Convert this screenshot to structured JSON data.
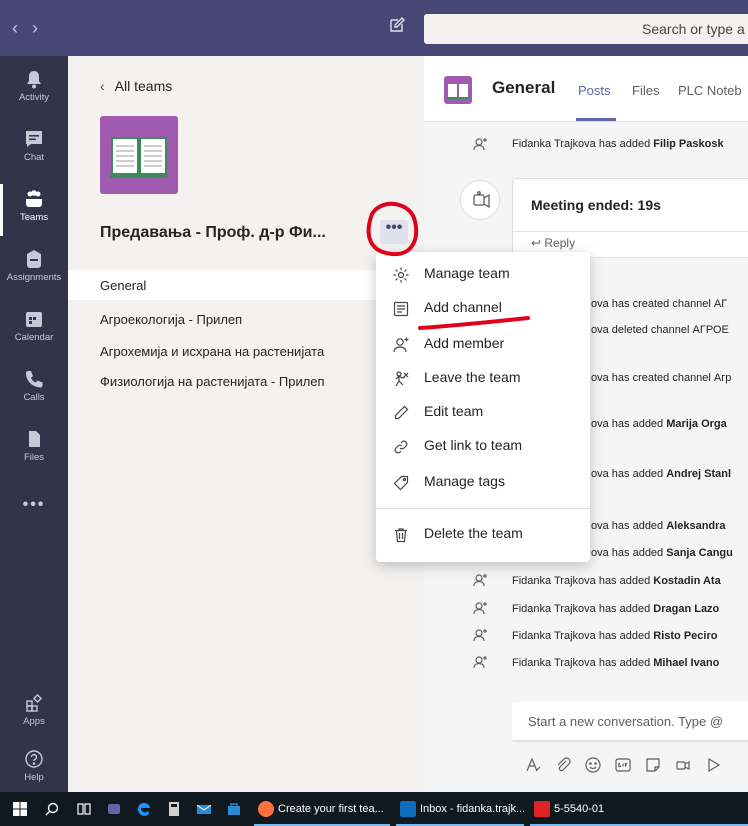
{
  "titlebar": {
    "back_glyph": "‹",
    "forward_glyph": "›",
    "search_placeholder": "Search or type a"
  },
  "rail": {
    "items": [
      {
        "label": "Activity",
        "icon": "bell-icon"
      },
      {
        "label": "Chat",
        "icon": "chat-icon"
      },
      {
        "label": "Teams",
        "icon": "teams-icon",
        "active": true
      },
      {
        "label": "Assignments",
        "icon": "assignments-icon"
      },
      {
        "label": "Calendar",
        "icon": "calendar-icon"
      },
      {
        "label": "Calls",
        "icon": "phone-icon"
      },
      {
        "label": "Files",
        "icon": "files-icon"
      }
    ],
    "more": "•••",
    "bottom": [
      {
        "label": "Apps",
        "icon": "apps-icon"
      },
      {
        "label": "Help",
        "icon": "help-icon"
      }
    ]
  },
  "panel": {
    "back_label": "All teams",
    "team_name": "Предавања - Проф. д-р Фи...",
    "more_glyph": "•••",
    "channels": [
      "General",
      "Агроекологија - Прилеп",
      "Агрохемија и исхрана на растенијата",
      "Физиологија на растенијата - Прилеп"
    ]
  },
  "chat": {
    "title": "General",
    "tabs": [
      "Posts",
      "Files",
      "PLC Noteb"
    ],
    "first_event": {
      "actor": "Fidanka Trajkova",
      "text": " has added ",
      "target": "Filip Paskosk"
    },
    "meeting": {
      "title": "Meeting ended: 19s",
      "reply": "Reply"
    },
    "partial_events": [
      {
        "text": "ova has created channel АГ",
        "bold": ""
      },
      {
        "text": "ova deleted channel АГРОЕ",
        "bold": ""
      },
      {
        "text": "ova has created channel Агр",
        "bold": ""
      },
      {
        "text": "ova has added ",
        "bold": "Marija Orga"
      },
      {
        "text": "ova has added ",
        "bold": "Andrej Stanl"
      },
      {
        "text": "ova has added ",
        "bold": "Aleksandra "
      },
      {
        "text": "ova has added ",
        "bold": "Sanja Cangu"
      }
    ],
    "events": [
      {
        "actor": "Fidanka Trajkova",
        "text": " has added ",
        "target": "Kostadin Ata"
      },
      {
        "actor": "Fidanka Trajkova",
        "text": " has added ",
        "target": "Dragan Lazo"
      },
      {
        "actor": "Fidanka Trajkova",
        "text": " has added ",
        "target": "Risto Peciro"
      },
      {
        "actor": "Fidanka Trajkova",
        "text": " has added ",
        "target": "Mihael Ivano"
      }
    ],
    "composer_placeholder": "Start a new conversation. Type @"
  },
  "menu": {
    "items": [
      {
        "label": "Manage team",
        "icon": "gear-icon"
      },
      {
        "label": "Add channel",
        "icon": "channel-icon"
      },
      {
        "label": "Add member",
        "icon": "add-person-icon"
      },
      {
        "label": "Leave the team",
        "icon": "leave-icon"
      },
      {
        "label": "Edit team",
        "icon": "pencil-icon"
      },
      {
        "label": "Get link to team",
        "icon": "link-icon"
      },
      {
        "label": "Manage tags",
        "icon": "tag-icon"
      },
      {
        "label": "Delete the team",
        "icon": "trash-icon"
      }
    ]
  },
  "taskbar": {
    "apps": [
      {
        "label": "Create your first tea...",
        "icon": "firefox-icon"
      },
      {
        "label": "Inbox - fidanka.trajk...",
        "icon": "outlook-icon"
      },
      {
        "label": "5-5540-01",
        "icon": "pdf-icon"
      }
    ]
  },
  "colors": {
    "titlebar": "#464775",
    "rail": "#33344a",
    "accent": "#6264a7",
    "team_logo": "#a05bb0",
    "annotation": "#e0001b"
  }
}
